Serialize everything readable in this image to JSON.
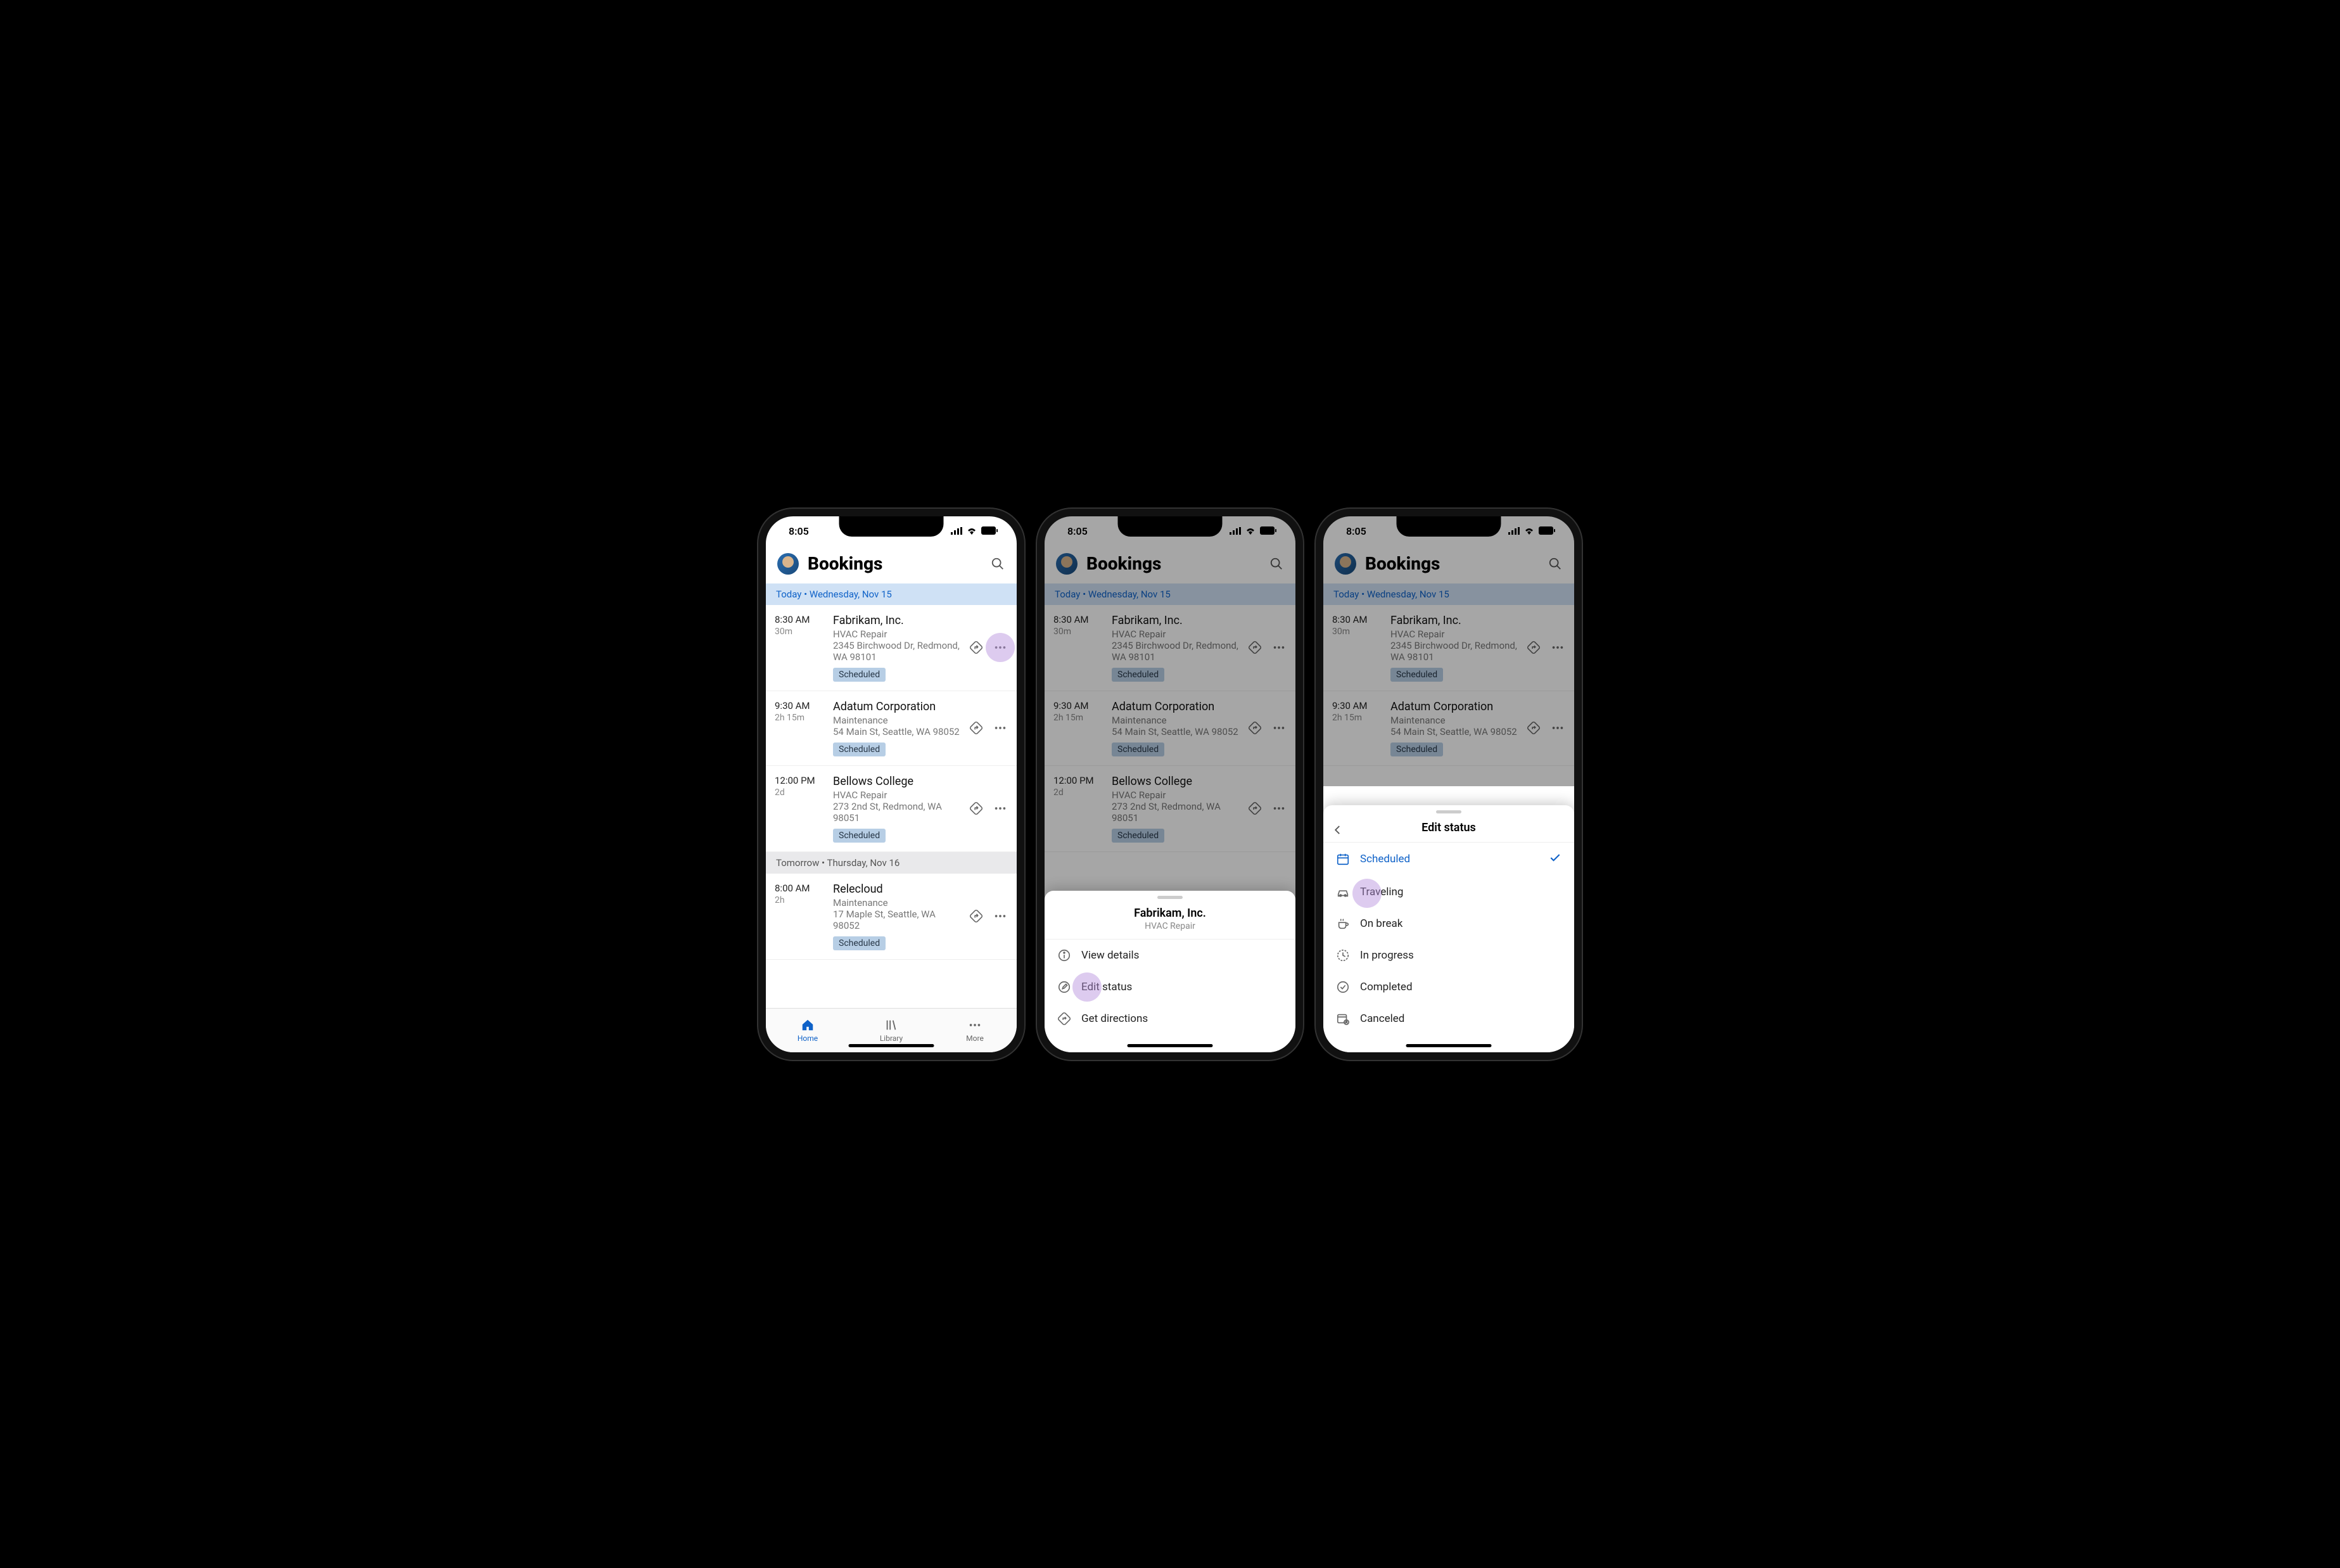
{
  "status_time": "8:05",
  "header": {
    "title": "Bookings"
  },
  "dates": {
    "today_label": "Today • Wednesday, Nov 15",
    "tomorrow_label": "Tomorrow • Thursday, Nov 16"
  },
  "bookings_today": [
    {
      "time": "8:30 AM",
      "duration": "30m",
      "customer": "Fabrikam, Inc.",
      "service": "HVAC Repair",
      "address": "2345 Birchwood Dr, Redmond, WA 98101",
      "status": "Scheduled"
    },
    {
      "time": "9:30 AM",
      "duration": "2h 15m",
      "customer": "Adatum Corporation",
      "service": "Maintenance",
      "address": "54 Main St, Seattle, WA 98052",
      "status": "Scheduled"
    },
    {
      "time": "12:00 PM",
      "duration": "2d",
      "customer": "Bellows College",
      "service": "HVAC Repair",
      "address": "273 2nd St, Redmond, WA 98051",
      "status": "Scheduled"
    }
  ],
  "bookings_tomorrow": [
    {
      "time": "8:00 AM",
      "duration": "2h",
      "customer": "Relecloud",
      "service": "Maintenance",
      "address": "17 Maple St, Seattle, WA 98052",
      "status": "Scheduled"
    }
  ],
  "tabs": {
    "home": "Home",
    "library": "Library",
    "more": "More"
  },
  "action_sheet": {
    "title": "Fabrikam, Inc.",
    "subtitle": "HVAC Repair",
    "view_details": "View details",
    "edit_status": "Edit status",
    "get_directions": "Get directions"
  },
  "status_sheet": {
    "title": "Edit status",
    "options": {
      "scheduled": "Scheduled",
      "traveling": "Traveling",
      "on_break": "On break",
      "in_progress": "In progress",
      "completed": "Completed",
      "canceled": "Canceled"
    }
  }
}
